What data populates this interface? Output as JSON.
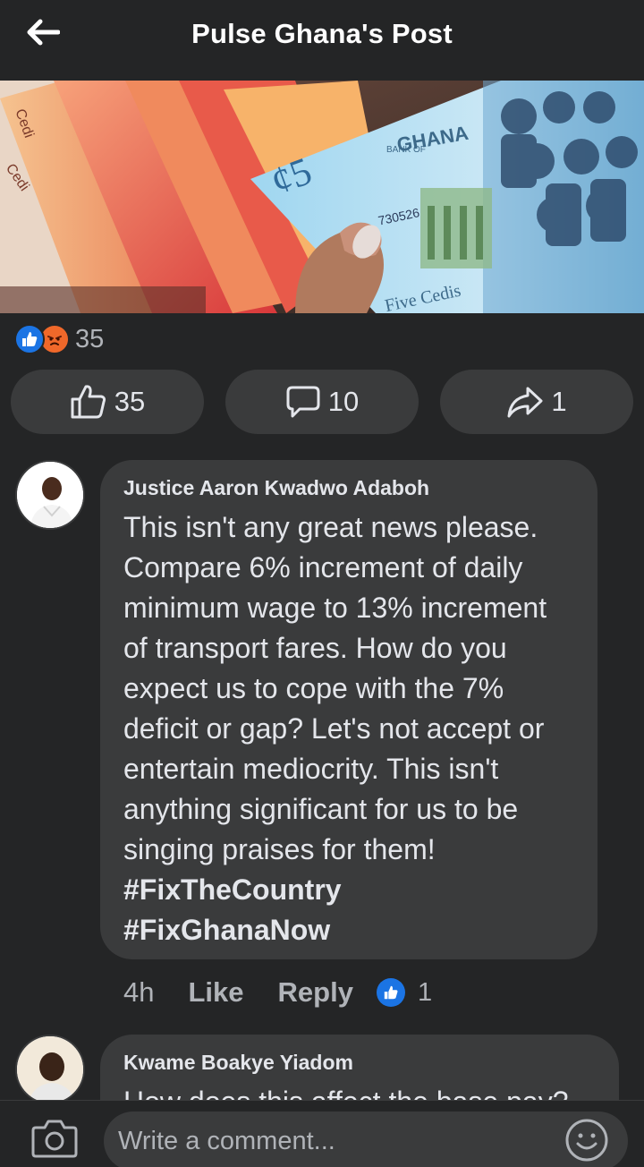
{
  "header": {
    "title": "Pulse Ghana's Post"
  },
  "post_image": {
    "banknote_denomination": "¢5",
    "bank_label": "BANK OF",
    "country_label": "GHANA",
    "serial": "730526",
    "note_text": "Five Cedis",
    "side_note_1": "Cedi",
    "side_note_2": "Cedi"
  },
  "reactions": {
    "icons": [
      "like-icon",
      "angry-icon"
    ],
    "count": "35"
  },
  "actions": {
    "like_count": "35",
    "comment_count": "10",
    "share_count": "1"
  },
  "comments": [
    {
      "author": "Justice Aaron Kwadwo Adaboh",
      "text": "This isn't any great news please. Compare 6% increment of daily minimum wage to 13% increment of transport fares. How do you expect us to cope with the 7% deficit or gap? Let's not accept or entertain mediocrity. This isn't anything significant for us to be singing praises for them!",
      "hashtags": [
        "#FixTheCountry",
        "#FixGhanaNow"
      ],
      "time": "4h",
      "like_label": "Like",
      "reply_label": "Reply",
      "reaction_count": "1"
    },
    {
      "author": "Kwame Boakye Yiadom",
      "text": "How does this affect the base pay?"
    }
  ],
  "composer": {
    "placeholder": "Write a comment..."
  },
  "colors": {
    "background": "#242526",
    "surface": "#3a3b3c",
    "text_primary": "#e4e6eb",
    "text_secondary": "#b0b3b8",
    "like_blue": "#1b74e4",
    "angry_orange": "#f0682a"
  }
}
